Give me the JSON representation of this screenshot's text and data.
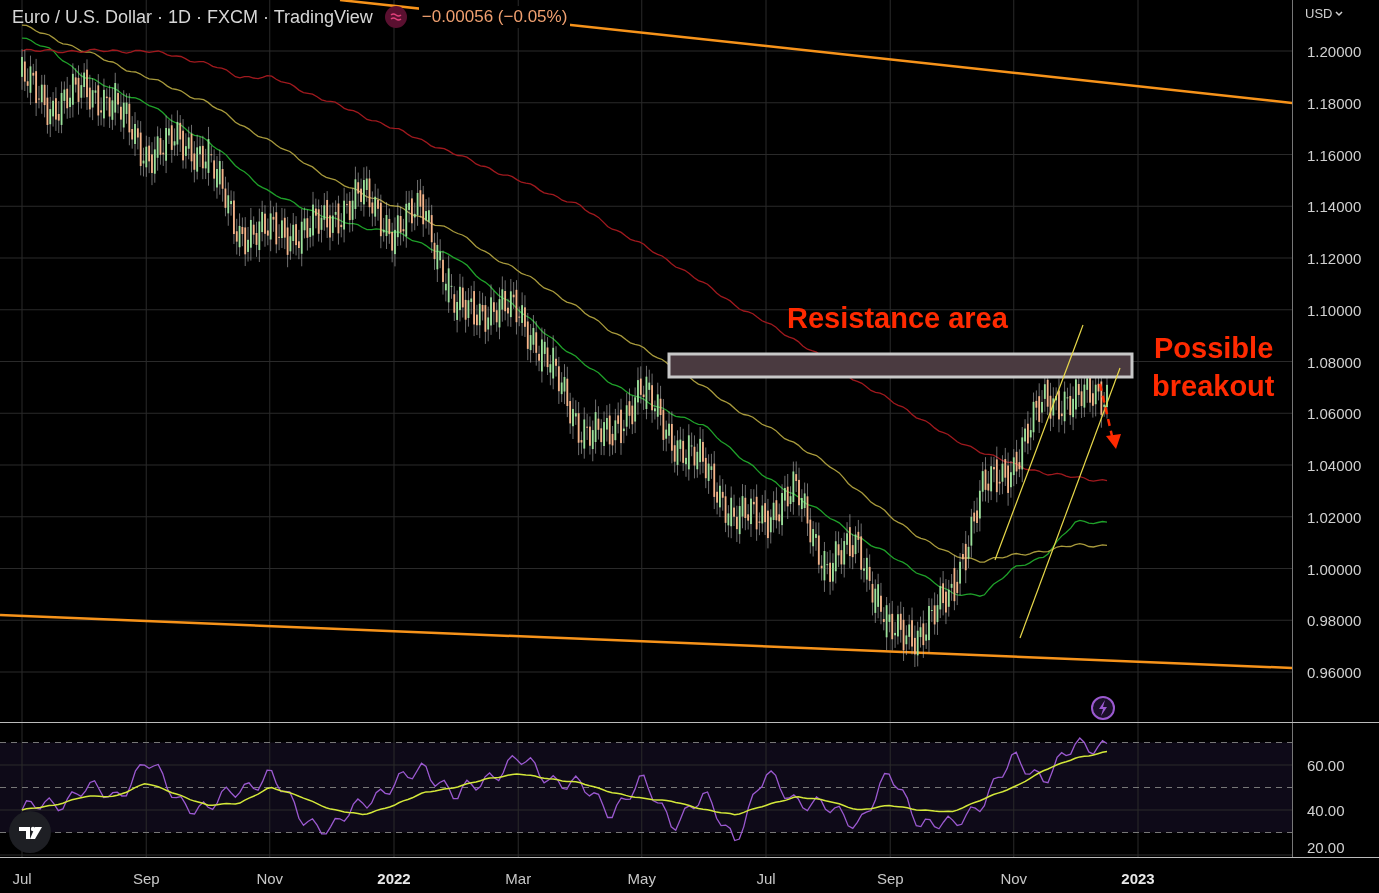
{
  "header": {
    "title": "Euro / U.S. Dollar · 1D · FXCM · TradingView",
    "change": "−0.00056 (−0.05%)"
  },
  "currency": "USD",
  "price_axis": [
    "1.20000",
    "1.18000",
    "1.16000",
    "1.14000",
    "1.12000",
    "1.10000",
    "1.08000",
    "1.06000",
    "1.04000",
    "1.02000",
    "1.00000",
    "0.98000",
    "0.96000"
  ],
  "drawings": [
    {
      "kind": "zone_label",
      "text": "Resistance area"
    },
    {
      "kind": "side_label",
      "text": "Possible"
    },
    {
      "kind": "side_label2",
      "text": "breakout"
    }
  ],
  "rsi_axis": [
    "60.00",
    "40.00",
    "20.00"
  ],
  "time_axis": [
    {
      "label": "Jul",
      "kind": "month"
    },
    {
      "label": "Sep",
      "kind": "month"
    },
    {
      "label": "Nov",
      "kind": "month"
    },
    {
      "label": "2022",
      "kind": "year"
    },
    {
      "label": "Mar",
      "kind": "month"
    },
    {
      "label": "May",
      "kind": "month"
    },
    {
      "label": "Jul",
      "kind": "month"
    },
    {
      "label": "Sep",
      "kind": "month"
    },
    {
      "label": "Nov",
      "kind": "month"
    },
    {
      "label": "2023",
      "kind": "year"
    }
  ]
}
